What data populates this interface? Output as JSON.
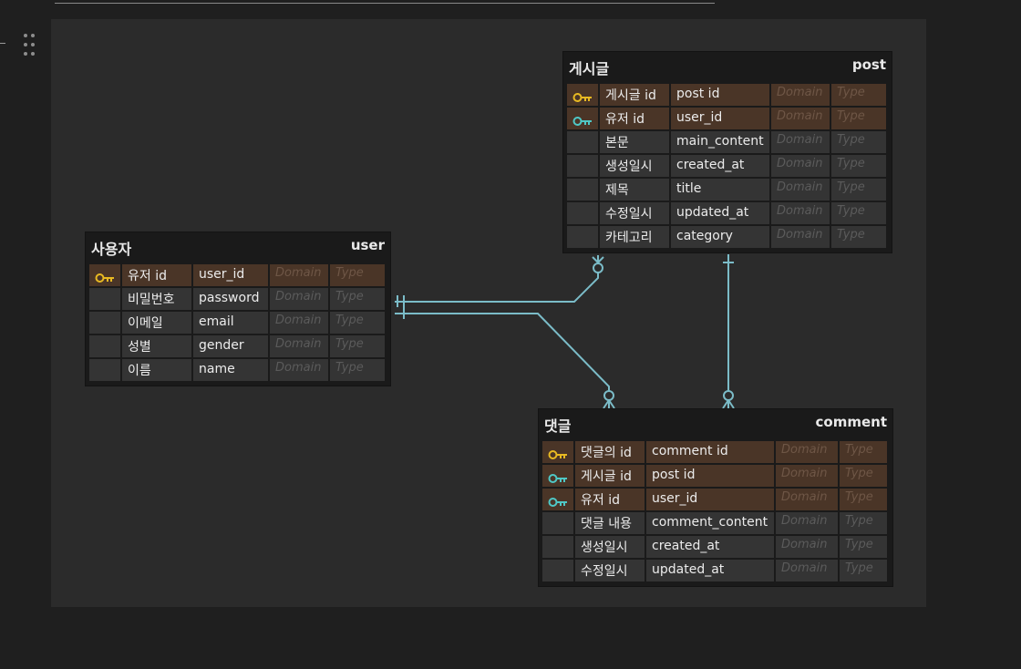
{
  "palette": {
    "canvas_bg": "#2b2b2b",
    "table_bg": "#1a1a1a",
    "cell_bg": "#343434",
    "key_row_bg": "#4a3527",
    "primary_key_color": "#e8b922",
    "foreign_key_color": "#4fc8c6",
    "relation_line_color": "#7bbcc8"
  },
  "tables": [
    {
      "id": "post",
      "logical_name": "게시글",
      "physical_name": "post",
      "columns": [
        {
          "key": "primary",
          "key_icon": "primary-key-icon",
          "logical": "게시글 id",
          "physical": "post id",
          "domain": "Domain",
          "type": "Type"
        },
        {
          "key": "foreign",
          "key_icon": "foreign-key-icon",
          "logical": "유저 id",
          "physical": "user_id",
          "domain": "Domain",
          "type": "Type"
        },
        {
          "key": "none",
          "logical": "본문",
          "physical": "main_content",
          "domain": "Domain",
          "type": "Type"
        },
        {
          "key": "none",
          "logical": "생성일시",
          "physical": "created_at",
          "domain": "Domain",
          "type": "Type"
        },
        {
          "key": "none",
          "logical": "제목",
          "physical": "title",
          "domain": "Domain",
          "type": "Type"
        },
        {
          "key": "none",
          "logical": "수정일시",
          "physical": "updated_at",
          "domain": "Domain",
          "type": "Type"
        },
        {
          "key": "none",
          "logical": "카테고리",
          "physical": "category",
          "domain": "Domain",
          "type": "Type"
        }
      ]
    },
    {
      "id": "user",
      "logical_name": "사용자",
      "physical_name": "user",
      "columns": [
        {
          "key": "primary",
          "key_icon": "primary-key-icon",
          "logical": "유저 id",
          "physical": "user_id",
          "domain": "Domain",
          "type": "Type"
        },
        {
          "key": "none",
          "logical": "비밀번호",
          "physical": "password",
          "domain": "Domain",
          "type": "Type"
        },
        {
          "key": "none",
          "logical": "이메일",
          "physical": "email",
          "domain": "Domain",
          "type": "Type"
        },
        {
          "key": "none",
          "logical": "성별",
          "physical": "gender",
          "domain": "Domain",
          "type": "Type"
        },
        {
          "key": "none",
          "logical": "이름",
          "physical": "name",
          "domain": "Domain",
          "type": "Type"
        }
      ]
    },
    {
      "id": "comment",
      "logical_name": "댓글",
      "physical_name": "comment",
      "columns": [
        {
          "key": "primary",
          "key_icon": "primary-key-icon",
          "logical": "댓글의 id",
          "physical": "comment id",
          "domain": "Domain",
          "type": "Type"
        },
        {
          "key": "foreign",
          "key_icon": "foreign-key-icon",
          "logical": "게시글 id",
          "physical": "post id",
          "domain": "Domain",
          "type": "Type"
        },
        {
          "key": "foreign",
          "key_icon": "foreign-key-icon",
          "logical": "유저 id",
          "physical": "user_id",
          "domain": "Domain",
          "type": "Type"
        },
        {
          "key": "none",
          "logical": "댓글 내용",
          "physical": "comment_content",
          "domain": "Domain",
          "type": "Type"
        },
        {
          "key": "none",
          "logical": "생성일시",
          "physical": "created_at",
          "domain": "Domain",
          "type": "Type"
        },
        {
          "key": "none",
          "logical": "수정일시",
          "physical": "updated_at",
          "domain": "Domain",
          "type": "Type"
        }
      ]
    }
  ],
  "relationships": [
    {
      "name": "user-to-post",
      "from": "user",
      "to": "post",
      "from_cardinality": "exactly-one",
      "to_cardinality": "zero-or-many"
    },
    {
      "name": "user-to-comment",
      "from": "user",
      "to": "comment",
      "from_cardinality": "exactly-one",
      "to_cardinality": "zero-or-many"
    },
    {
      "name": "post-to-comment",
      "from": "post",
      "to": "comment",
      "from_cardinality": "exactly-one",
      "to_cardinality": "zero-or-many"
    }
  ]
}
